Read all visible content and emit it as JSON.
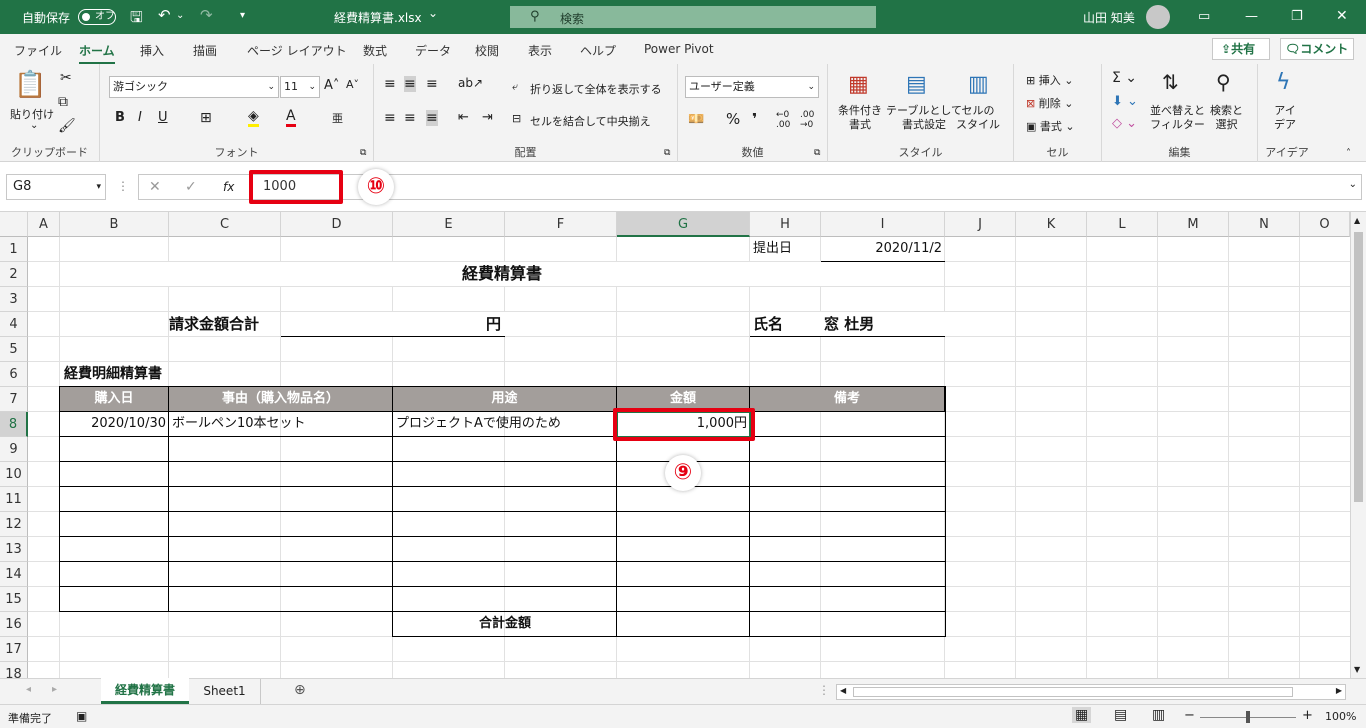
{
  "titlebar": {
    "autosave_label": "自動保存",
    "autosave_toggle": "オフ",
    "filename": "経費精算書.xlsx",
    "filename_arrow": "⌄",
    "search_placeholder": "検索",
    "user_name": "山田 知美"
  },
  "tabs": [
    "ファイル",
    "ホーム",
    "挿入",
    "描画",
    "ページ レイアウト",
    "数式",
    "データ",
    "校閲",
    "表示",
    "ヘルプ",
    "Power Pivot"
  ],
  "share_label": "共有",
  "comment_label": "コメント",
  "ribbon": {
    "clipboard": {
      "paste_label": "貼り付け",
      "group_label": "クリップボード"
    },
    "font": {
      "font_name": "游ゴシック",
      "font_size": "11",
      "bold": "B",
      "italic": "I",
      "underline": "U",
      "group_label": "フォント"
    },
    "alignment": {
      "wrap_label": "折り返して全体を表示する",
      "merge_label": "セルを結合して中央揃え",
      "group_label": "配置"
    },
    "number": {
      "format": "ユーザー定義",
      "group_label": "数値"
    },
    "styles": {
      "cond_label": "条件付き\n書式",
      "table_label": "テーブルとして\n書式設定",
      "cell_style_label": "セルの\nスタイル",
      "group_label": "スタイル"
    },
    "cells": {
      "insert_label": "挿入",
      "delete_label": "削除",
      "format_label": "書式",
      "group_label": "セル"
    },
    "editing": {
      "sort_label": "並べ替えと\nフィルター",
      "find_label": "検索と\n選択",
      "group_label": "編集"
    },
    "ideas": {
      "label": "アイ\nデア",
      "group_label": "アイデア"
    }
  },
  "formula_bar": {
    "name_box": "G8",
    "fx": "fx",
    "value": "1000"
  },
  "columns": [
    "A",
    "B",
    "C",
    "D",
    "E",
    "F",
    "G",
    "H",
    "I",
    "J",
    "K",
    "L",
    "M",
    "N",
    "O"
  ],
  "rows": [
    "1",
    "2",
    "3",
    "4",
    "5",
    "6",
    "7",
    "8",
    "9",
    "10",
    "11",
    "12",
    "13",
    "14",
    "15",
    "16",
    "17",
    "18"
  ],
  "sheet": {
    "submit_label": "提出日",
    "submit_date": "2020/11/2",
    "title": "経費精算書",
    "claim_total_label": "請求金額合計",
    "yen": "円",
    "name_label": "氏名",
    "name_value": "窓 杜男",
    "detail_title": "経費明細精算書",
    "headers": [
      "購入日",
      "事由（購入物品名）",
      "用途",
      "金額",
      "備考"
    ],
    "row8": {
      "date": "2020/10/30",
      "item": "ボールペン10本セット",
      "use": "プロジェクトAで使用のため",
      "amount": "1,000円"
    },
    "total_label": "合計金額"
  },
  "annotations": {
    "nine": "⑨",
    "ten": "⑩"
  },
  "sheet_tabs": [
    "経費精算書",
    "Sheet1"
  ],
  "status": {
    "ready": "準備完了",
    "zoom": "100%"
  },
  "colors": {
    "excel_green": "#217346",
    "header_fill": "#a39e9b",
    "annotation_red": "#e60012"
  }
}
